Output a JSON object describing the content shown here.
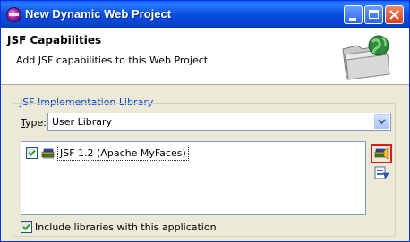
{
  "window": {
    "title": "New Dynamic Web Project"
  },
  "header": {
    "title": "JSF Capabilities",
    "description": "Add JSF capabilities to this Web Project"
  },
  "group": {
    "label": "JSF Implementation Library"
  },
  "type_field": {
    "label_prefix": "",
    "label_mnemonic": "T",
    "label_rest": "ype:",
    "selected_value": "User Library"
  },
  "library_list": {
    "items": [
      {
        "label": "JSF 1.2 (Apache MyFaces)",
        "checked": true
      }
    ]
  },
  "include_libraries": {
    "label": "Include libraries with this application",
    "checked": true
  },
  "icons": {
    "app": "eclipse-icon",
    "banner": "folder-globe-icon",
    "library": "library-books-icon",
    "manage": "manage-libraries-icon",
    "download": "download-library-icon"
  },
  "colors": {
    "titlebar": "#0a4fe0",
    "group_label": "#0046d5",
    "highlight_border": "#e01818"
  }
}
